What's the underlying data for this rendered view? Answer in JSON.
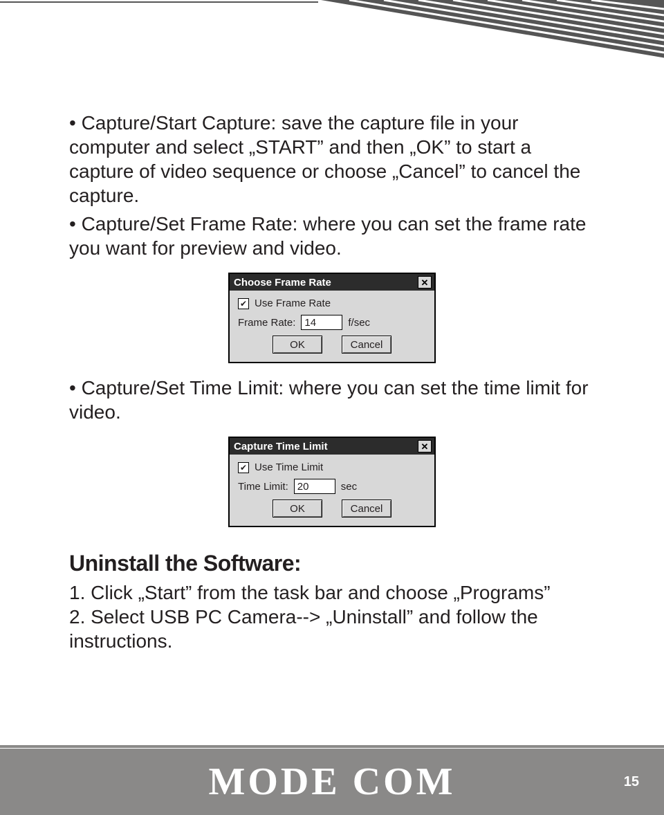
{
  "bullets": {
    "b1": "• Capture/Start Capture: save the capture file in your computer and select „START” and then „OK” to start a capture of video sequence or choose „Cancel” to cancel the capture.",
    "b2": "• Capture/Set Frame Rate: where you can set the frame rate you want for preview and video.",
    "b3": "• Capture/Set Time Limit: where you can set the time limit for video."
  },
  "heading": "Uninstall the Software:",
  "steps": {
    "s1": "1. Click „Start” from the task bar and choose „Programs”",
    "s2": "2. Select USB PC Camera--> „Uninstall” and follow the instructions."
  },
  "dialog1": {
    "title": "Choose Frame Rate",
    "check_label": "Use Frame Rate",
    "row_label": "Frame Rate:",
    "value": "14",
    "unit": "f/sec",
    "ok": "OK",
    "cancel": "Cancel"
  },
  "dialog2": {
    "title": "Capture Time Limit",
    "check_label": "Use Time Limit",
    "row_label": "Time Limit:",
    "value": "20",
    "unit": "sec",
    "ok": "OK",
    "cancel": "Cancel"
  },
  "footer": {
    "brand": "MODE COM",
    "page": "15"
  }
}
